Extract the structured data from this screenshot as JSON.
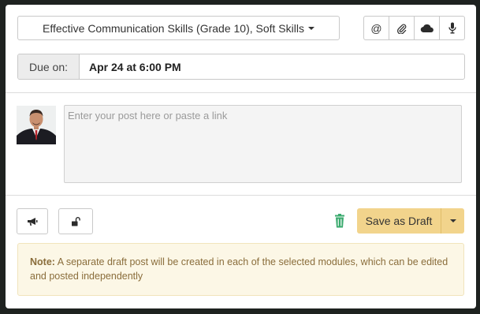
{
  "header": {
    "module_select_label": "Effective Communication Skills (Grade 10), Soft Skills"
  },
  "toolbar": {
    "icons": [
      "at-icon",
      "paperclip-icon",
      "cloud-icon",
      "microphone-icon"
    ],
    "at_glyph": "@"
  },
  "due": {
    "label": "Due on:",
    "value": "Apr 24 at 6:00 PM"
  },
  "composer": {
    "placeholder": "Enter your post here or paste a link"
  },
  "actions": {
    "save_label": "Save as Draft",
    "trash_color": "#3aaa6e",
    "save_color": "#f2d48c"
  },
  "note": {
    "prefix": "Note:",
    "text": " A separate draft post will be created in each of the selected modules, which can be edited and posted independently"
  }
}
